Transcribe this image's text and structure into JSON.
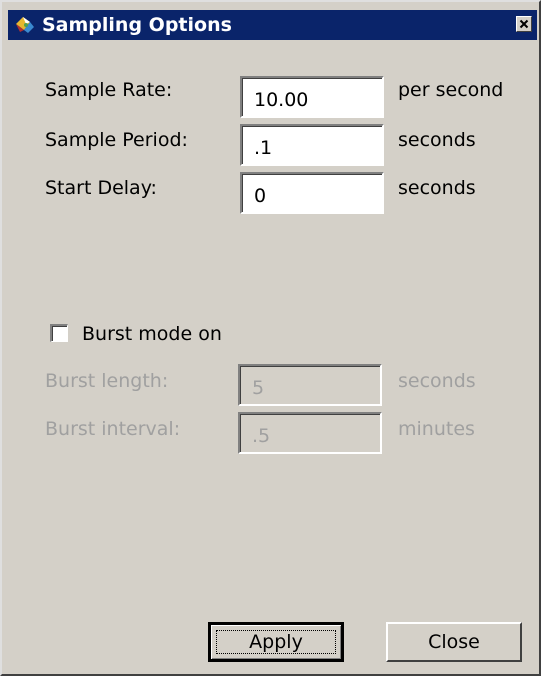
{
  "window": {
    "title": "Sampling Options",
    "icon": "app-icon",
    "close_icon": "close-icon"
  },
  "sampling": {
    "rate": {
      "label": "Sample Rate:",
      "value": "10.00",
      "unit": "per second"
    },
    "period": {
      "label": "Sample Period:",
      "value": ".1",
      "unit": "seconds"
    },
    "delay": {
      "label": "Start Delay:",
      "value": "0",
      "unit": "seconds"
    }
  },
  "burst": {
    "checkbox_label": "Burst mode on",
    "checked": false,
    "length": {
      "label": "Burst length:",
      "value": "5",
      "unit": "seconds",
      "enabled": false
    },
    "interval": {
      "label": "Burst interval:",
      "value": ".5",
      "unit": "minutes",
      "enabled": false
    }
  },
  "buttons": {
    "apply_label": "Apply",
    "close_label": "Close"
  },
  "colors": {
    "titlebar": "#0a246a",
    "dialog_face": "#d4d0c8",
    "disabled_text": "#a0a0a0"
  }
}
